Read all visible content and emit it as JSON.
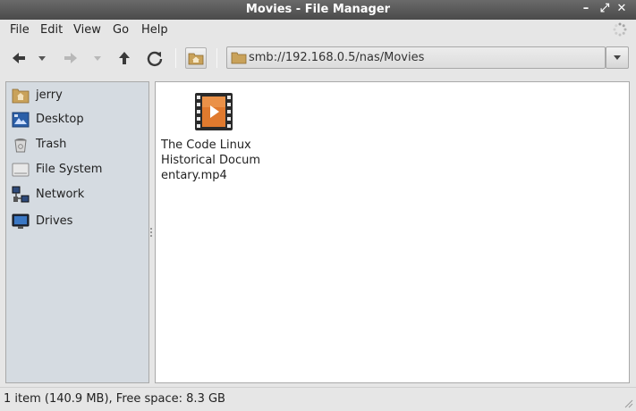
{
  "window": {
    "title": "Movies - File Manager",
    "minimize_glyph": "–",
    "maximize_glyph": "⤢",
    "close_glyph": "✕"
  },
  "menu": [
    "File",
    "Edit",
    "View",
    "Go",
    "Help"
  ],
  "toolbar": {
    "back_icon": "arrow-left-icon",
    "forward_icon": "arrow-right-icon",
    "up_icon": "arrow-up-icon",
    "reload_icon": "reload-icon",
    "home_icon": "home-folder-icon"
  },
  "location": {
    "path": "smb://192.168.0.5/nas/Movies"
  },
  "sidebar": {
    "items": [
      {
        "label": "jerry",
        "icon": "home-folder-icon"
      },
      {
        "label": "Desktop",
        "icon": "desktop-icon"
      },
      {
        "label": "Trash",
        "icon": "trash-icon"
      },
      {
        "label": "File System",
        "icon": "harddisk-icon"
      },
      {
        "label": "Network",
        "icon": "network-icon"
      },
      {
        "label": "Drives",
        "icon": "monitor-icon"
      }
    ]
  },
  "files": [
    {
      "name": "The Code Linux Historical Documentary.mp4",
      "icon": "video-file-icon"
    }
  ],
  "status": {
    "text": "1 item (140.9 MB), Free space: 8.3 GB"
  },
  "colors": {
    "titlebar": "#555555",
    "sidebar_bg": "#d5dbe1",
    "folder": "#c9a25a",
    "video_orange": "#e07a2e"
  }
}
